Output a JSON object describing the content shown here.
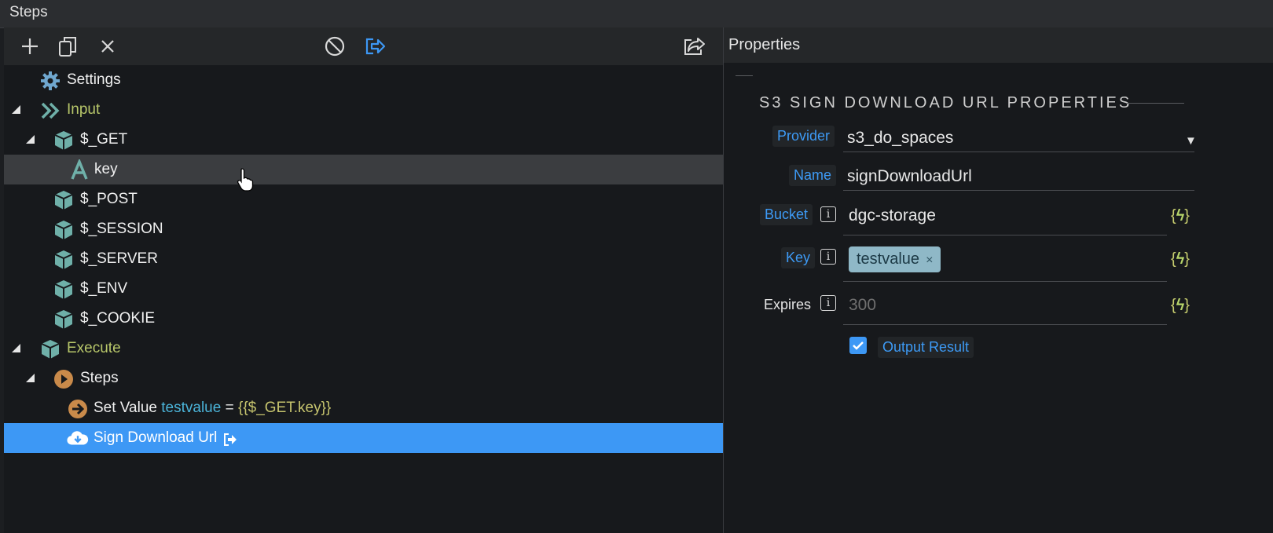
{
  "window": {
    "title": "Steps"
  },
  "toolbar": {
    "buttons": [
      {
        "name": "add-step-button",
        "icon": "plus-icon"
      },
      {
        "name": "duplicate-step-button",
        "icon": "copy-icon"
      },
      {
        "name": "delete-step-button",
        "icon": "close-icon"
      },
      {
        "name": "disable-step-button",
        "icon": "ban-icon"
      },
      {
        "name": "output-step-button",
        "icon": "output-icon"
      },
      {
        "name": "share-button",
        "icon": "share-icon"
      }
    ]
  },
  "tree": {
    "settings": "Settings",
    "input": "Input",
    "get": "$_GET",
    "key": "key",
    "post": "$_POST",
    "session": "$_SESSION",
    "server": "$_SERVER",
    "env": "$_ENV",
    "cookie": "$_COOKIE",
    "execute": "Execute",
    "steps": "Steps",
    "set_value": {
      "label": "Set Value",
      "var": "testvalue",
      "eq": "=",
      "expr": "{{$_GET.key}}"
    },
    "sign_download": "Sign Download Url"
  },
  "properties": {
    "header": "Properties",
    "section_title": "S3 SIGN DOWNLOAD URL PROPERTIES",
    "provider": {
      "label": "Provider",
      "value": "s3_do_spaces"
    },
    "name": {
      "label": "Name",
      "value": "signDownloadUrl"
    },
    "bucket": {
      "label": "Bucket",
      "value": "dgc-storage"
    },
    "key": {
      "label": "Key",
      "tag": "testvalue",
      "tag_remove": "×"
    },
    "expires": {
      "label": "Expires",
      "placeholder": "300"
    },
    "output": {
      "label": "Output Result",
      "checked": true
    },
    "info_glyph": "i",
    "dynamic_glyph": "{",
    "dynamic_glyph_close": "}",
    "dropdown_glyph": "▼"
  },
  "colors": {
    "accent": "#3d98f5",
    "selected_row": "#3d98f5",
    "cube": "#6fb0a9",
    "orange": "#c98a4a",
    "green_label": "#b8c76a"
  }
}
